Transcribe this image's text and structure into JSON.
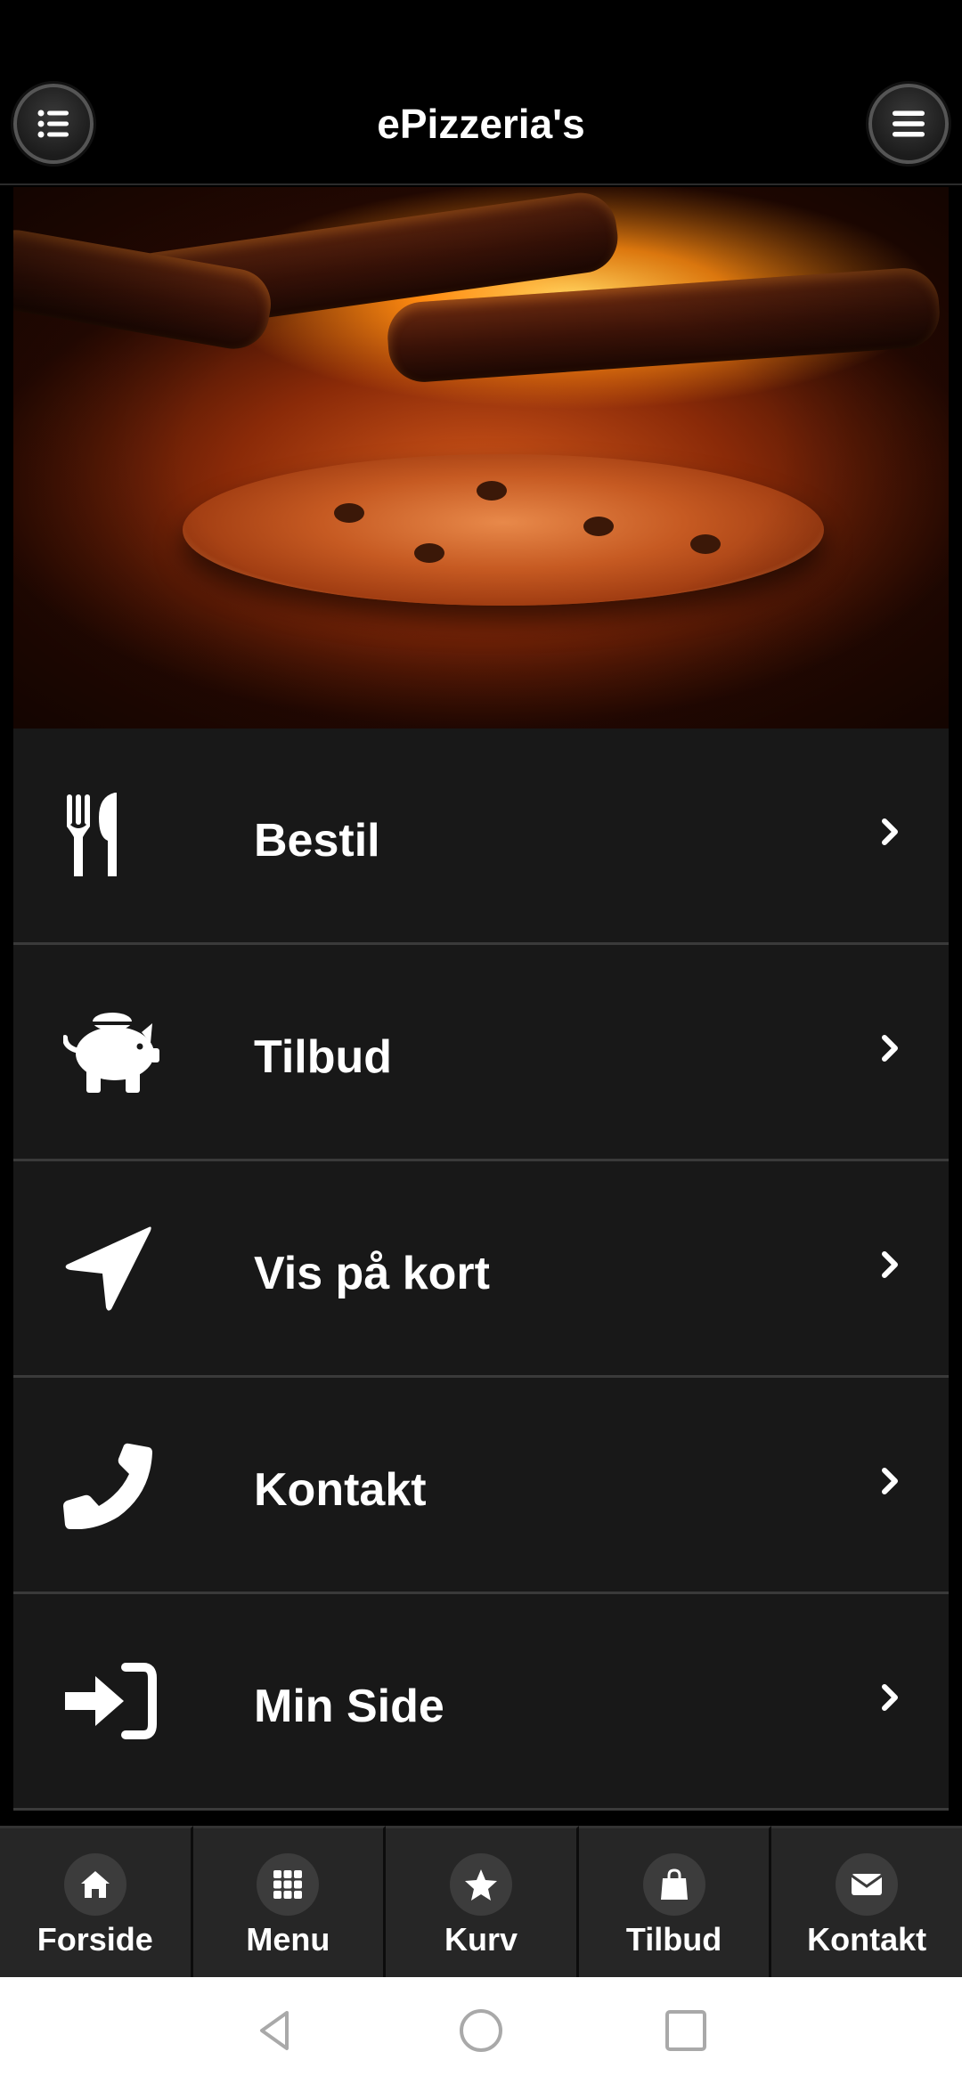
{
  "header": {
    "title": "ePizzeria's",
    "left_button_icon": "list-icon",
    "right_button_icon": "hamburger-menu-icon"
  },
  "menu": {
    "items": [
      {
        "label": "Bestil",
        "icon": "fork-knife-icon"
      },
      {
        "label": "Tilbud",
        "icon": "piggy-bank-icon"
      },
      {
        "label": "Vis på kort",
        "icon": "location-arrow-icon"
      },
      {
        "label": "Kontakt",
        "icon": "phone-icon"
      },
      {
        "label": "Min Side",
        "icon": "sign-in-icon"
      }
    ]
  },
  "tabbar": {
    "tabs": [
      {
        "label": "Forside",
        "icon": "home-icon"
      },
      {
        "label": "Menu",
        "icon": "grid-icon"
      },
      {
        "label": "Kurv",
        "icon": "star-icon"
      },
      {
        "label": "Tilbud",
        "icon": "shopping-bag-icon"
      },
      {
        "label": "Kontakt",
        "icon": "envelope-icon"
      }
    ]
  },
  "colors": {
    "background": "#000000",
    "list_background": "#181818",
    "tab_background": "#262626",
    "text": "#ffffff"
  }
}
